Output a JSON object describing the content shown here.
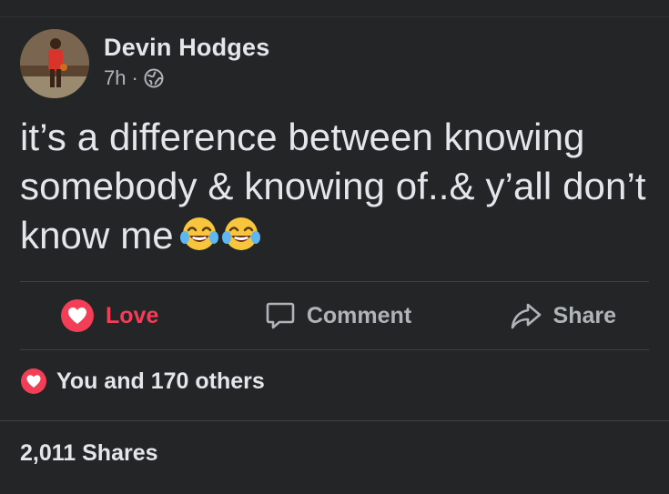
{
  "post": {
    "author": "Devin Hodges",
    "time": "7h",
    "separator": "·",
    "audience_icon": "globe-icon",
    "text": "it’s a difference between knowing somebody & knowing of..& y’all don’t know me",
    "emojis": [
      "face-with-tears-of-joy-icon",
      "face-with-tears-of-joy-icon"
    ]
  },
  "actions": {
    "love_label": "Love",
    "comment_label": "Comment",
    "share_label": "Share"
  },
  "reactions": {
    "summary": "You and 170 others",
    "icon": "heart-reaction-icon"
  },
  "shares": {
    "label": "2,011 Shares"
  },
  "colors": {
    "background": "#242526",
    "primary_text": "#e4e6eb",
    "secondary_text": "#b0b3b8",
    "love": "#f33e58",
    "divider": "#3e4042"
  }
}
